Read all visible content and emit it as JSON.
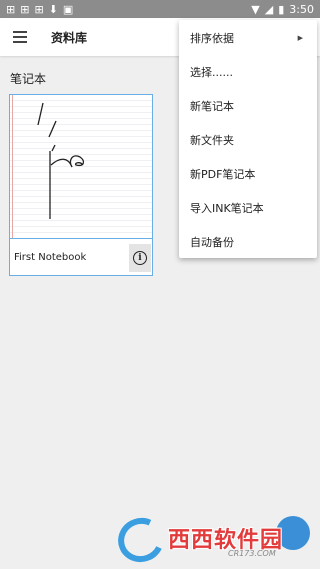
{
  "status_bar": {
    "left_icons": [
      "notification-icon",
      "notification-icon",
      "notification-icon",
      "download-icon",
      "image-icon"
    ],
    "time": "3:50",
    "bar_color": "#8c8c8c"
  },
  "app_bar": {
    "title": "资料库"
  },
  "section": {
    "title": "笔记本"
  },
  "notebooks": [
    {
      "name": "First Notebook"
    }
  ],
  "overflow_menu": {
    "items": [
      {
        "label": "排序依据",
        "has_submenu": true
      },
      {
        "label": "选择......"
      },
      {
        "label": "新笔记本"
      },
      {
        "label": "新文件夹"
      },
      {
        "label": "新PDF笔记本"
      },
      {
        "label": "导入INK笔记本"
      },
      {
        "label": "自动备份"
      }
    ]
  },
  "watermark": {
    "site": "西西软件园",
    "domain": "CR173.COM"
  },
  "colors": {
    "accent": "#6aaee8",
    "background": "#efefef"
  }
}
